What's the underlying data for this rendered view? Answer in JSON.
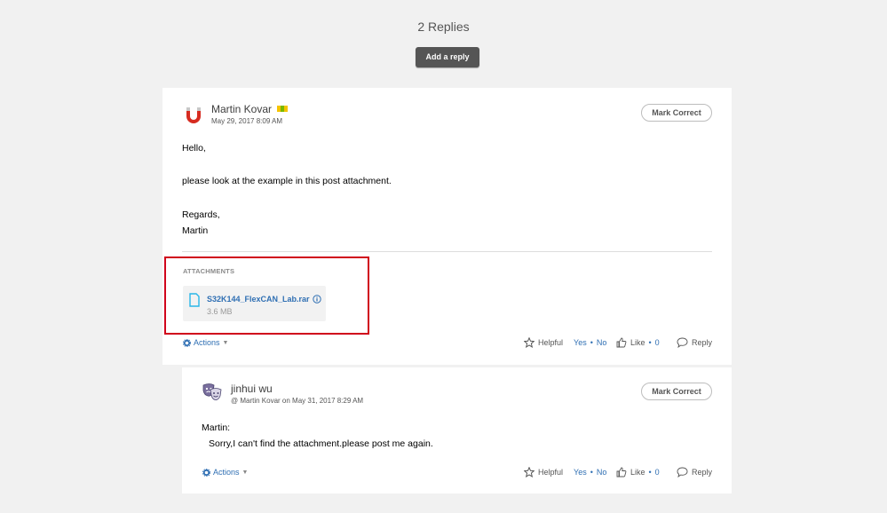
{
  "header": {
    "replies_count": "2 Replies",
    "add_reply_label": "Add a reply"
  },
  "colors": {
    "accent_link": "#2f6fb3",
    "button_dark": "#555555",
    "highlight_red": "#d0021b"
  },
  "replies": [
    {
      "author": "Martin Kovar",
      "badge_icon": "nxp-badge-icon",
      "avatar_icon": "magnet-icon",
      "date": "May 29, 2017 8:09 AM",
      "mark_correct_label": "Mark Correct",
      "body": [
        "Hello,",
        "please look at the example in this post attachment.",
        "Regards,",
        "Martin"
      ],
      "attachments_label": "ATTACHMENTS",
      "attachment": {
        "name": "S32K144_FlexCAN_Lab.rar",
        "size": "3.6 MB"
      },
      "actions_label": "Actions",
      "helpful_label": "Helpful",
      "yes_label": "Yes",
      "no_label": "No",
      "like_label": "Like",
      "like_count": "0",
      "reply_label": "Reply"
    },
    {
      "author": "jinhui wu",
      "avatar_icon": "theater-masks-icon",
      "reply_to": "@ Martin Kovar on May 31, 2017 8:29 AM",
      "mark_correct_label": "Mark Correct",
      "body": [
        "Martin:",
        "Sorry,I can't find the attachment.please post me again."
      ],
      "actions_label": "Actions",
      "helpful_label": "Helpful",
      "yes_label": "Yes",
      "no_label": "No",
      "like_label": "Like",
      "like_count": "0",
      "reply_label": "Reply"
    }
  ]
}
